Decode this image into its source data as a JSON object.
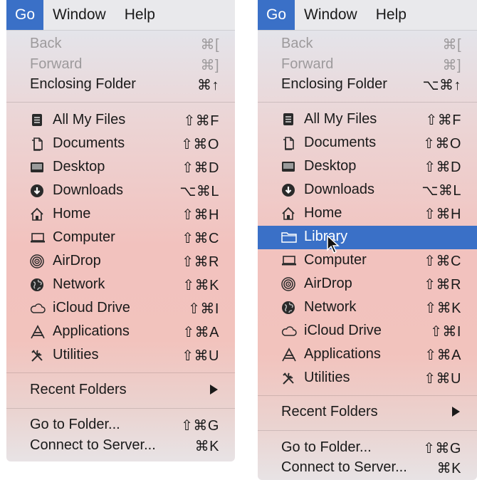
{
  "menubar": {
    "go": "Go",
    "window": "Window",
    "help": "Help"
  },
  "items": {
    "back": {
      "label": "Back",
      "left_shortcut": "⌘[",
      "right_shortcut": "⌘["
    },
    "forward": {
      "label": "Forward",
      "left_shortcut": "⌘]",
      "right_shortcut": "⌘]"
    },
    "enclosing": {
      "label": "Enclosing Folder",
      "left_shortcut": "⌘↑",
      "right_shortcut": "⌥⌘↑"
    },
    "all_files": {
      "label": "All My Files",
      "shortcut": "⇧⌘F",
      "icon": "all-files-icon"
    },
    "documents": {
      "label": "Documents",
      "shortcut": "⇧⌘O",
      "icon": "documents-icon"
    },
    "desktop": {
      "label": "Desktop",
      "shortcut": "⇧⌘D",
      "icon": "desktop-icon"
    },
    "downloads": {
      "label": "Downloads",
      "shortcut": "⌥⌘L",
      "icon": "downloads-icon"
    },
    "home": {
      "label": "Home",
      "shortcut": "⇧⌘H",
      "icon": "home-icon"
    },
    "library": {
      "label": "Library",
      "icon": "folder-icon"
    },
    "computer": {
      "label": "Computer",
      "shortcut": "⇧⌘C",
      "icon": "computer-icon"
    },
    "airdrop": {
      "label": "AirDrop",
      "shortcut": "⇧⌘R",
      "icon": "airdrop-icon"
    },
    "network": {
      "label": "Network",
      "shortcut": "⇧⌘K",
      "icon": "network-icon"
    },
    "icloud": {
      "label": "iCloud Drive",
      "shortcut": "⇧⌘I",
      "icon": "cloud-icon"
    },
    "applications": {
      "label": "Applications",
      "shortcut": "⇧⌘A",
      "icon": "applications-icon"
    },
    "utilities": {
      "label": "Utilities",
      "shortcut": "⇧⌘U",
      "icon": "utilities-icon"
    },
    "recent": {
      "label": "Recent Folders"
    },
    "goto": {
      "label": "Go to Folder...",
      "shortcut": "⇧⌘G"
    },
    "connect": {
      "label": "Connect to Server...",
      "shortcut": "⌘K"
    }
  },
  "colors": {
    "accent": "#3a70c7",
    "disabled": "#9d9a9c"
  }
}
